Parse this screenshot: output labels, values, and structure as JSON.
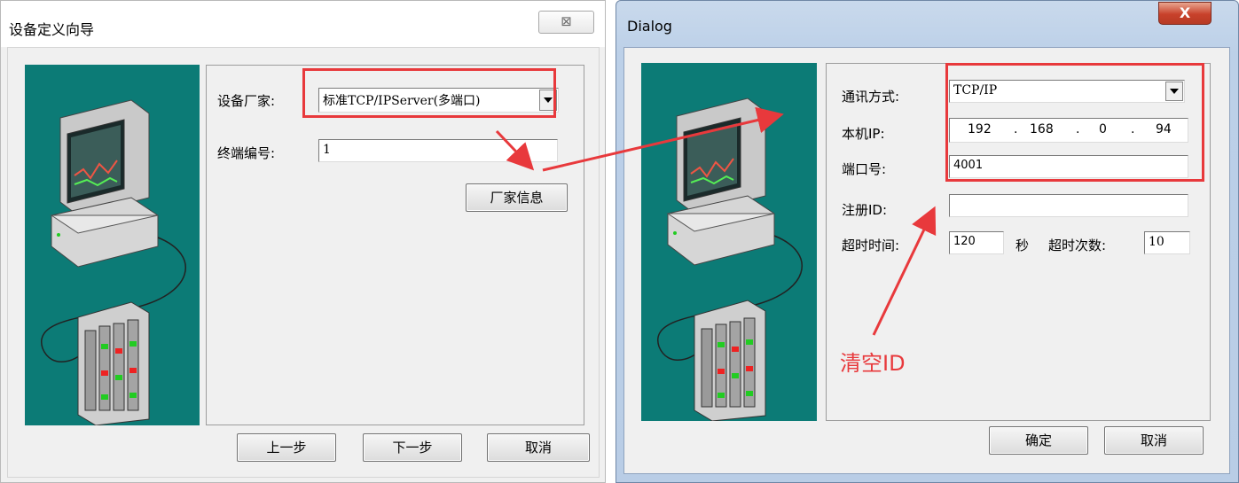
{
  "left_window": {
    "title": "设备定义向导",
    "close_glyph": "⊠",
    "vendor_label": "设备厂家:",
    "vendor_value": "标准TCP/IPServer(多端口)",
    "terminal_label": "终端编号:",
    "terminal_value": "1",
    "vendor_info_button": "厂家信息",
    "prev_button": "上一步",
    "next_button": "下一步",
    "cancel_button": "取消"
  },
  "right_window": {
    "title": "Dialog",
    "close_glyph": "X",
    "comm_label": "通讯方式:",
    "comm_value": "TCP/IP",
    "local_ip_label": "本机IP:",
    "ip_octets": [
      "192",
      "168",
      "0",
      "94"
    ],
    "port_label": "端口号:",
    "port_value": "4001",
    "register_id_label": "注册ID:",
    "register_id_value": "",
    "timeout_label": "超时时间:",
    "timeout_value": "120",
    "seconds_unit": "秒",
    "retries_label": "超时次数:",
    "retries_value": "10",
    "ok_button": "确定",
    "cancel_button": "取消"
  },
  "annotation": {
    "clear_id_text": "清空ID",
    "color": "#e8393c"
  },
  "colors": {
    "teal_panel": "#0c7b76",
    "window_face": "#f0f0f0"
  },
  "icons": [
    "computer-monitor-icon",
    "device-rack-icon"
  ]
}
